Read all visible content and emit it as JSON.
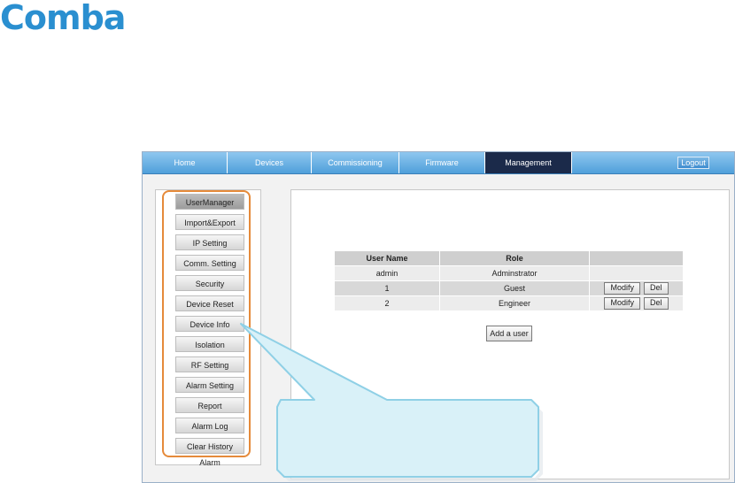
{
  "brand": {
    "logo_text": "Comba"
  },
  "nav": {
    "tabs": [
      {
        "label": "Home"
      },
      {
        "label": "Devices"
      },
      {
        "label": "Commissioning"
      },
      {
        "label": "Firmware"
      },
      {
        "label": "Management",
        "active": true
      }
    ],
    "logout_label": "Logout"
  },
  "sidebar": {
    "items": [
      {
        "label": "UserManager",
        "active": true
      },
      {
        "label": "Import&Export"
      },
      {
        "label": "IP Setting"
      },
      {
        "label": "Comm. Setting"
      },
      {
        "label": "Security"
      },
      {
        "label": "Device Reset"
      },
      {
        "label": "Device Info"
      },
      {
        "label": "Isolation"
      },
      {
        "label": "RF Setting"
      },
      {
        "label": "Alarm Setting"
      },
      {
        "label": "Report"
      },
      {
        "label": "Alarm Log"
      },
      {
        "label": "Clear History Alarm"
      }
    ]
  },
  "user_table": {
    "columns": [
      "User Name",
      "Role",
      ""
    ],
    "rows": [
      {
        "name": "admin",
        "role": "Adminstrator",
        "actions": []
      },
      {
        "name": "1",
        "role": "Guest",
        "actions": [
          "Modify",
          "Del"
        ]
      },
      {
        "name": "2",
        "role": "Engineer",
        "actions": [
          "Modify",
          "Del"
        ]
      }
    ]
  },
  "add_user_label": "Add a user",
  "colors": {
    "accent_orange": "#e58a3a",
    "nav_active": "#1b2a4a",
    "callout_fill": "#d9f1f8",
    "callout_stroke": "#8fd0e6"
  }
}
